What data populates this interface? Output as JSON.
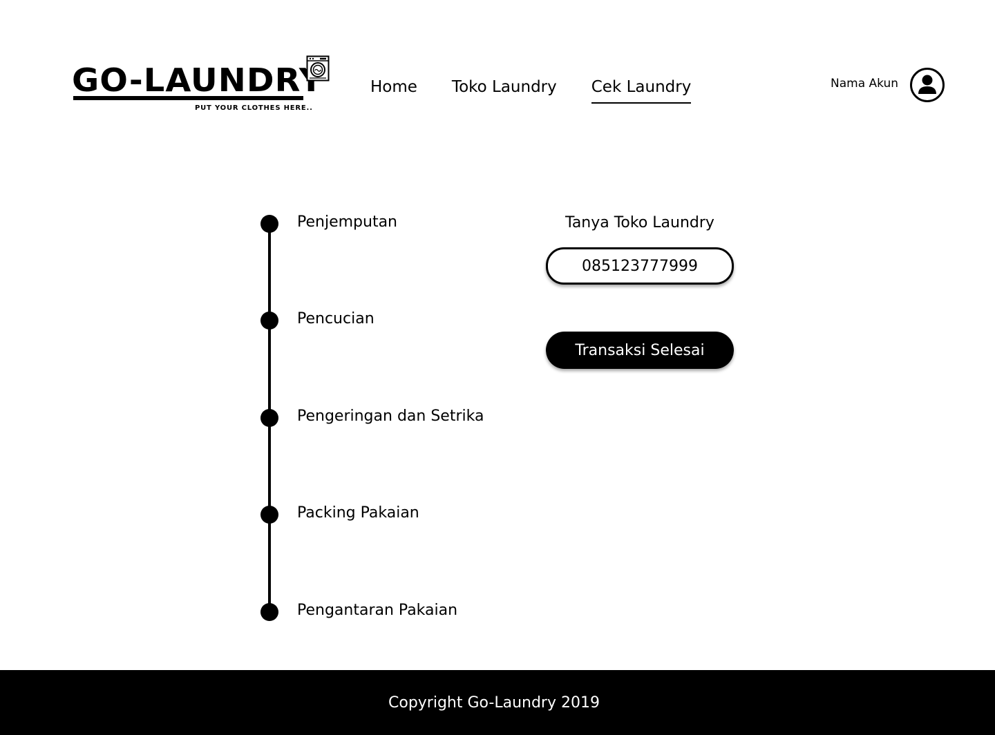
{
  "brand": {
    "name": "GO-LAUNDRY",
    "tagline": "PUT YOUR CLOTHES HERE.."
  },
  "nav": {
    "items": [
      {
        "label": "Home",
        "active": false
      },
      {
        "label": "Toko Laundry",
        "active": false
      },
      {
        "label": "Cek Laundry",
        "active": true
      }
    ]
  },
  "account": {
    "name": "Nama Akun",
    "avatar_icon": "user-circle-icon"
  },
  "timeline": {
    "steps": [
      {
        "label": "Penjemputan"
      },
      {
        "label": "Pencucian"
      },
      {
        "label": "Pengeringan dan Setrika"
      },
      {
        "label": "Packing Pakaian"
      },
      {
        "label": "Pengantaran Pakaian"
      }
    ]
  },
  "contact": {
    "title": "Tanya Toko Laundry",
    "phone": "085123777999"
  },
  "actions": {
    "done_label": "Transaksi Selesai"
  },
  "footer": {
    "copyright": "Copyright Go-Laundry 2019"
  },
  "colors": {
    "primary": "#000000",
    "background": "#ffffff",
    "footer_text": "#ffffff"
  }
}
